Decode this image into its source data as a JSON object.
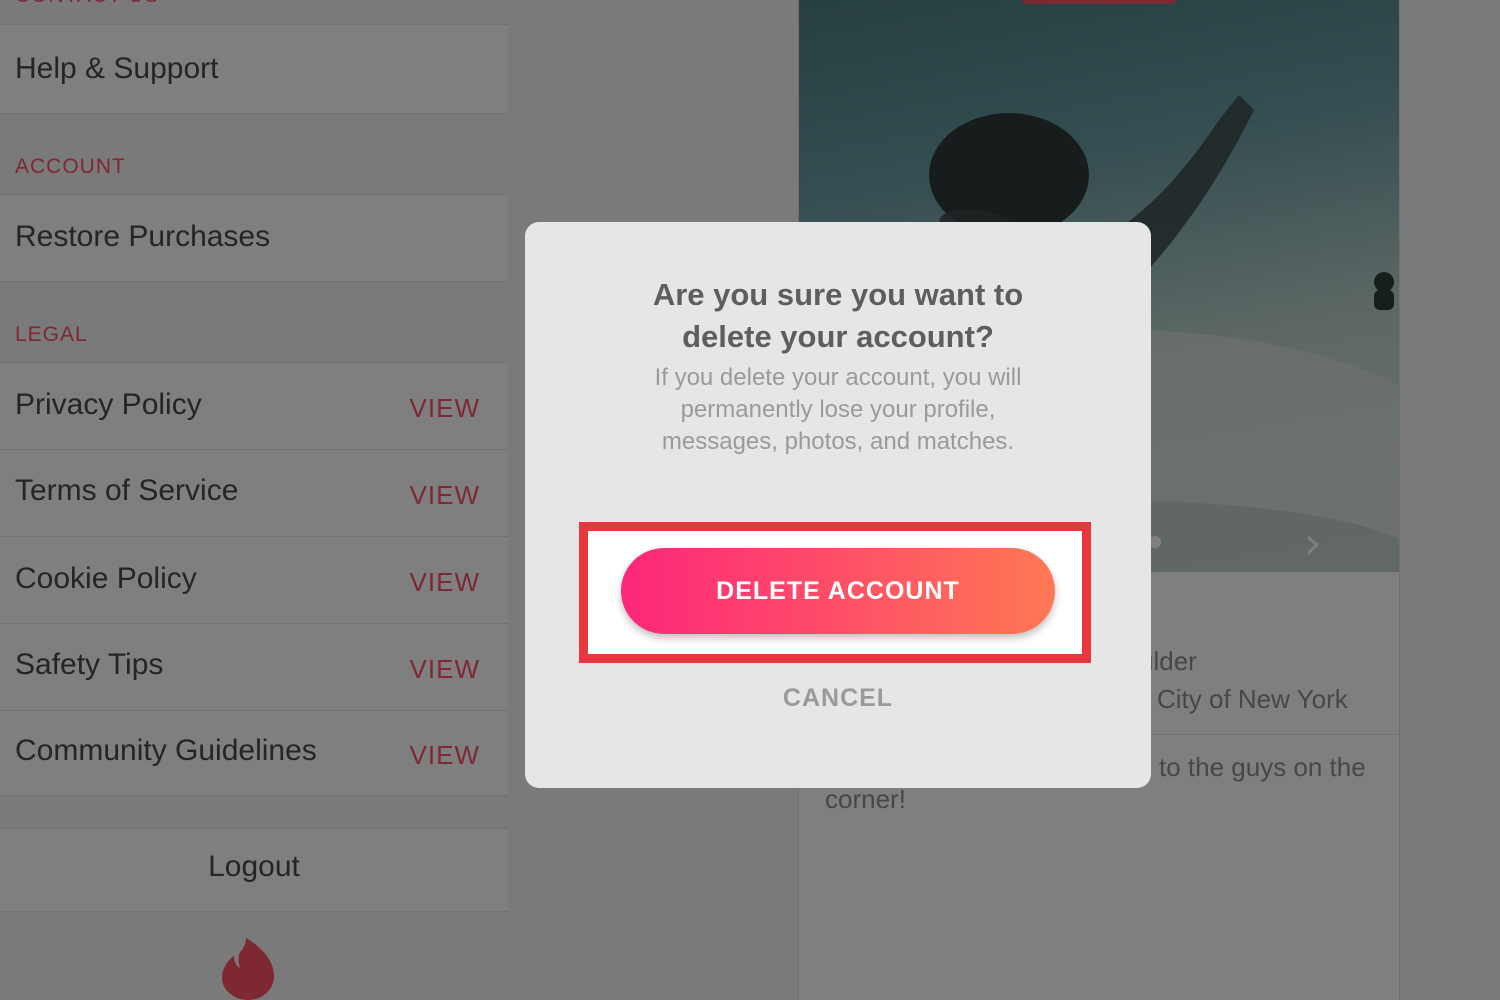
{
  "settings": {
    "contact_header": "CONTACT US",
    "help_label": "Help & Support",
    "account_header": "ACCOUNT",
    "restore_label": "Restore Purchases",
    "legal_header": "LEGAL",
    "legal_items": [
      {
        "label": "Privacy Policy",
        "action": "VIEW"
      },
      {
        "label": "Terms of Service",
        "action": "VIEW"
      },
      {
        "label": "Cookie Policy",
        "action": "VIEW"
      },
      {
        "label": "Safety Tips",
        "action": "VIEW"
      },
      {
        "label": "Community Guidelines",
        "action": "VIEW"
      }
    ],
    "logout_label": "Logout",
    "logo_icon": "tinder-flame-icon"
  },
  "profile": {
    "job_partial": "ulder",
    "location_partial": "City of New York",
    "bio_line1": "to the guys on the",
    "bio_line2": "corner!",
    "next_icon": "chevron-right-icon"
  },
  "dialog": {
    "title": "Are you sure you want to delete your account?",
    "message": "If you delete your account, you will permanently lose your profile, messages, photos, and matches.",
    "delete_label": "DELETE ACCOUNT",
    "cancel_label": "CANCEL"
  },
  "colors": {
    "brand": "#fd5068",
    "gradient_start": "#fd267a",
    "gradient_end": "#ff7854",
    "highlight": "#e8383f"
  }
}
